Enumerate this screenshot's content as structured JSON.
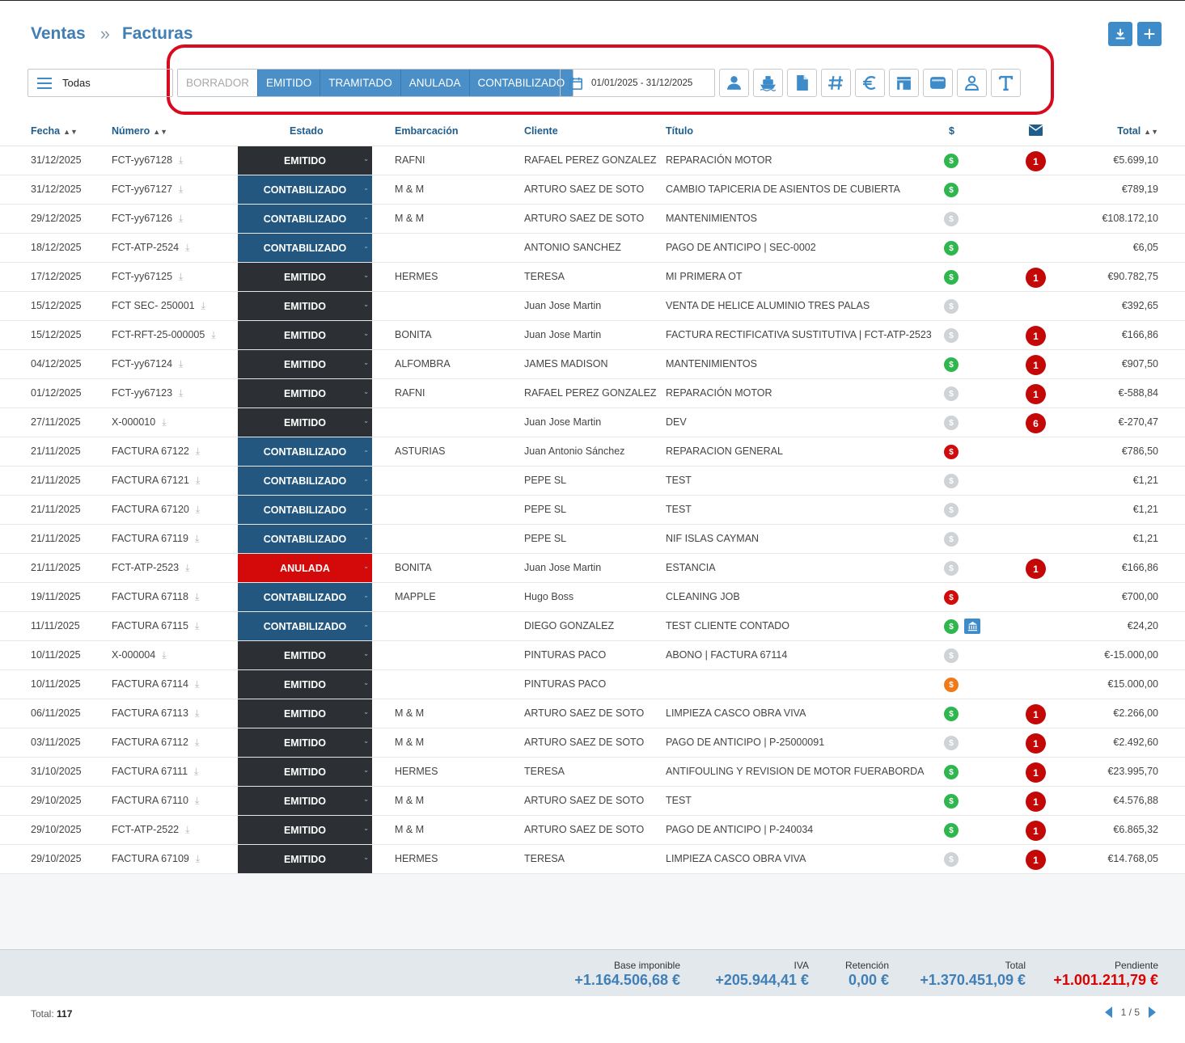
{
  "breadcrumb": {
    "section": "Ventas",
    "separator": "»",
    "page": "Facturas"
  },
  "filter": {
    "view": "Todas",
    "states": [
      {
        "label": "BORRADOR",
        "active": false
      },
      {
        "label": "EMITIDO",
        "active": true
      },
      {
        "label": "TRAMITADO",
        "active": true
      },
      {
        "label": "ANULADA",
        "active": true
      },
      {
        "label": "CONTABILIZADO",
        "active": true
      }
    ],
    "date_range": "01/01/2025 - 31/12/2025"
  },
  "columns": {
    "fecha": "Fecha",
    "numero": "Número",
    "estado": "Estado",
    "embarcacion": "Embarcación",
    "cliente": "Cliente",
    "titulo": "Título",
    "dollar": "$",
    "total": "Total"
  },
  "rows": [
    {
      "fecha": "31/12/2025",
      "numero": "FCT-yy67128",
      "estado": "EMITIDO",
      "emb": "RAFNI",
      "cliente": "RAFAEL PEREZ GONZALEZ",
      "titulo": "REPARACIÓN MOTOR",
      "pay": "green",
      "mail": "1",
      "total": "€5.699,10"
    },
    {
      "fecha": "31/12/2025",
      "numero": "FCT-yy67127",
      "estado": "CONTABILIZADO",
      "emb": "M & M",
      "cliente": "ARTURO SAEZ DE SOTO",
      "titulo": "CAMBIO TAPICERIA DE ASIENTOS DE CUBIERTA",
      "pay": "green",
      "mail": "",
      "total": "€789,19"
    },
    {
      "fecha": "29/12/2025",
      "numero": "FCT-yy67126",
      "estado": "CONTABILIZADO",
      "emb": "M & M",
      "cliente": "ARTURO SAEZ DE SOTO",
      "titulo": "MANTENIMIENTOS",
      "pay": "gray",
      "mail": "",
      "total": "€108.172,10"
    },
    {
      "fecha": "18/12/2025",
      "numero": "FCT-ATP-2524",
      "estado": "CONTABILIZADO",
      "emb": "",
      "cliente": "ANTONIO SANCHEZ",
      "titulo": "PAGO DE ANTICIPO | SEC-0002",
      "pay": "green",
      "mail": "",
      "total": "€6,05"
    },
    {
      "fecha": "17/12/2025",
      "numero": "FCT-yy67125",
      "estado": "EMITIDO",
      "emb": "HERMES",
      "cliente": "TERESA",
      "titulo": "MI PRIMERA OT",
      "pay": "green",
      "mail": "1",
      "total": "€90.782,75"
    },
    {
      "fecha": "15/12/2025",
      "numero": "FCT SEC- 250001",
      "estado": "EMITIDO",
      "emb": "",
      "cliente": "Juan Jose Martin",
      "titulo": "VENTA DE HELICE ALUMINIO TRES PALAS",
      "pay": "gray",
      "mail": "",
      "total": "€392,65"
    },
    {
      "fecha": "15/12/2025",
      "numero": "FCT-RFT-25-000005",
      "estado": "EMITIDO",
      "emb": "BONITA",
      "cliente": "Juan Jose Martin",
      "titulo": "FACTURA RECTIFICATIVA SUSTITUTIVA | FCT-ATP-2523",
      "pay": "gray",
      "mail": "1",
      "total": "€166,86"
    },
    {
      "fecha": "04/12/2025",
      "numero": "FCT-yy67124",
      "estado": "EMITIDO",
      "emb": "ALFOMBRA",
      "cliente": "JAMES MADISON",
      "titulo": "MANTENIMIENTOS",
      "pay": "green",
      "mail": "1",
      "total": "€907,50"
    },
    {
      "fecha": "01/12/2025",
      "numero": "FCT-yy67123",
      "estado": "EMITIDO",
      "emb": "RAFNI",
      "cliente": "RAFAEL PEREZ GONZALEZ",
      "titulo": "REPARACIÓN MOTOR",
      "pay": "gray",
      "mail": "1",
      "total": "€-588,84"
    },
    {
      "fecha": "27/11/2025",
      "numero": "X-000010",
      "estado": "EMITIDO",
      "emb": "",
      "cliente": "Juan Jose Martin",
      "titulo": "DEV",
      "pay": "gray",
      "mail": "6",
      "total": "€-270,47"
    },
    {
      "fecha": "21/11/2025",
      "numero": "FACTURA 67122",
      "estado": "CONTABILIZADO",
      "emb": "ASTURIAS",
      "cliente": "Juan Antonio Sánchez",
      "titulo": "REPARACION GENERAL",
      "pay": "red",
      "mail": "",
      "total": "€786,50"
    },
    {
      "fecha": "21/11/2025",
      "numero": "FACTURA 67121",
      "estado": "CONTABILIZADO",
      "emb": "",
      "cliente": "PEPE SL",
      "titulo": "TEST",
      "pay": "gray",
      "mail": "",
      "total": "€1,21"
    },
    {
      "fecha": "21/11/2025",
      "numero": "FACTURA 67120",
      "estado": "CONTABILIZADO",
      "emb": "",
      "cliente": "PEPE SL",
      "titulo": "TEST",
      "pay": "gray",
      "mail": "",
      "total": "€1,21"
    },
    {
      "fecha": "21/11/2025",
      "numero": "FACTURA 67119",
      "estado": "CONTABILIZADO",
      "emb": "",
      "cliente": "PEPE SL",
      "titulo": "NIF ISLAS CAYMAN",
      "pay": "gray",
      "mail": "",
      "total": "€1,21"
    },
    {
      "fecha": "21/11/2025",
      "numero": "FCT-ATP-2523",
      "estado": "ANULADA",
      "emb": "BONITA",
      "cliente": "Juan Jose Martin",
      "titulo": "ESTANCIA",
      "pay": "gray",
      "mail": "1",
      "total": "€166,86"
    },
    {
      "fecha": "19/11/2025",
      "numero": "FACTURA 67118",
      "estado": "CONTABILIZADO",
      "emb": "MAPPLE",
      "cliente": "Hugo Boss",
      "titulo": "CLEANING JOB",
      "pay": "red",
      "mail": "",
      "total": "€700,00"
    },
    {
      "fecha": "11/11/2025",
      "numero": "FACTURA 67115",
      "estado": "CONTABILIZADO",
      "emb": "",
      "cliente": "DIEGO GONZALEZ",
      "titulo": "TEST CLIENTE CONTADO",
      "pay": "green",
      "bank": true,
      "mail": "",
      "total": "€24,20"
    },
    {
      "fecha": "10/11/2025",
      "numero": "X-000004",
      "estado": "EMITIDO",
      "emb": "",
      "cliente": "PINTURAS PACO",
      "titulo": "ABONO | FACTURA 67114",
      "pay": "gray",
      "mail": "",
      "total": "€-15.000,00"
    },
    {
      "fecha": "10/11/2025",
      "numero": "FACTURA 67114",
      "estado": "EMITIDO",
      "emb": "",
      "cliente": "PINTURAS PACO",
      "titulo": "",
      "pay": "orange",
      "mail": "",
      "total": "€15.000,00"
    },
    {
      "fecha": "06/11/2025",
      "numero": "FACTURA 67113",
      "estado": "EMITIDO",
      "emb": "M & M",
      "cliente": "ARTURO SAEZ DE SOTO",
      "titulo": "LIMPIEZA CASCO OBRA VIVA",
      "pay": "green",
      "mail": "1",
      "total": "€2.266,00"
    },
    {
      "fecha": "03/11/2025",
      "numero": "FACTURA 67112",
      "estado": "EMITIDO",
      "emb": "M & M",
      "cliente": "ARTURO SAEZ DE SOTO",
      "titulo": "PAGO DE ANTICIPO | P-25000091",
      "pay": "gray",
      "mail": "1",
      "total": "€2.492,60"
    },
    {
      "fecha": "31/10/2025",
      "numero": "FACTURA 67111",
      "estado": "EMITIDO",
      "emb": "HERMES",
      "cliente": "TERESA",
      "titulo": "ANTIFOULING Y REVISION DE MOTOR FUERABORDA",
      "pay": "green",
      "mail": "1",
      "total": "€23.995,70"
    },
    {
      "fecha": "29/10/2025",
      "numero": "FACTURA 67110",
      "estado": "EMITIDO",
      "emb": "M & M",
      "cliente": "ARTURO SAEZ DE SOTO",
      "titulo": "TEST",
      "pay": "green",
      "mail": "1",
      "total": "€4.576,88"
    },
    {
      "fecha": "29/10/2025",
      "numero": "FCT-ATP-2522",
      "estado": "EMITIDO",
      "emb": "M & M",
      "cliente": "ARTURO SAEZ DE SOTO",
      "titulo": "PAGO DE ANTICIPO | P-240034",
      "pay": "green",
      "mail": "1",
      "total": "€6.865,32"
    },
    {
      "fecha": "29/10/2025",
      "numero": "FACTURA 67109",
      "estado": "EMITIDO",
      "emb": "HERMES",
      "cliente": "TERESA",
      "titulo": "LIMPIEZA CASCO OBRA VIVA",
      "pay": "gray",
      "mail": "1",
      "total": "€14.768,05"
    }
  ],
  "summary": {
    "base_label": "Base imponible",
    "base_value": "+1.164.506,68 €",
    "iva_label": "IVA",
    "iva_value": "+205.944,41 €",
    "ret_label": "Retención",
    "ret_value": "0,00 €",
    "total_label": "Total",
    "total_value": "+1.370.451,09 €",
    "pend_label": "Pendiente",
    "pend_value": "+1.001.211,79 €"
  },
  "footer": {
    "total_label": "Total:",
    "total_count": "117",
    "page": "1 / 5"
  },
  "colors": {
    "accent": "#3f7fb6",
    "emitido": "#2c2f33",
    "contabilizado": "#23577f",
    "anulada": "#d40a0a",
    "highlight": "#d9091e"
  }
}
